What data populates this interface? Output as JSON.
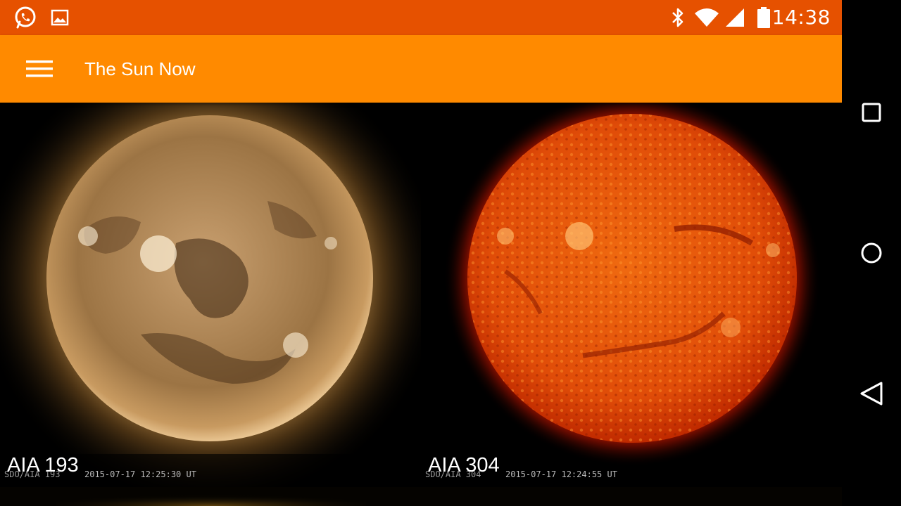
{
  "status_bar": {
    "time": "14:38",
    "icons": [
      "whatsapp-icon",
      "gallery-icon",
      "bluetooth-icon",
      "wifi-icon",
      "cell-signal-icon",
      "battery-icon"
    ],
    "background": "#e65100"
  },
  "app_bar": {
    "title": "The Sun Now",
    "menu_icon": "hamburger-menu-icon",
    "background": "#ff8a00"
  },
  "tiles": [
    {
      "label": "AIA 193",
      "instrument": "SDO/AIA  193",
      "timestamp": "2015-07-17 12:25:30 UT",
      "colors": {
        "core": "#c9a070",
        "limb": "#7a5528",
        "corona": "#caa064",
        "dark": "#3a2410"
      }
    },
    {
      "label": "AIA 304",
      "instrument": "SDO/AIA  304",
      "timestamp": "2015-07-17 12:24:55 UT",
      "colors": {
        "core": "#f46a10",
        "limb": "#c02a00",
        "corona": "#ff2a00",
        "dark": "#8a1a00"
      }
    }
  ],
  "nav_bar": {
    "buttons": [
      "recent-apps-icon",
      "home-icon",
      "back-icon"
    ]
  }
}
